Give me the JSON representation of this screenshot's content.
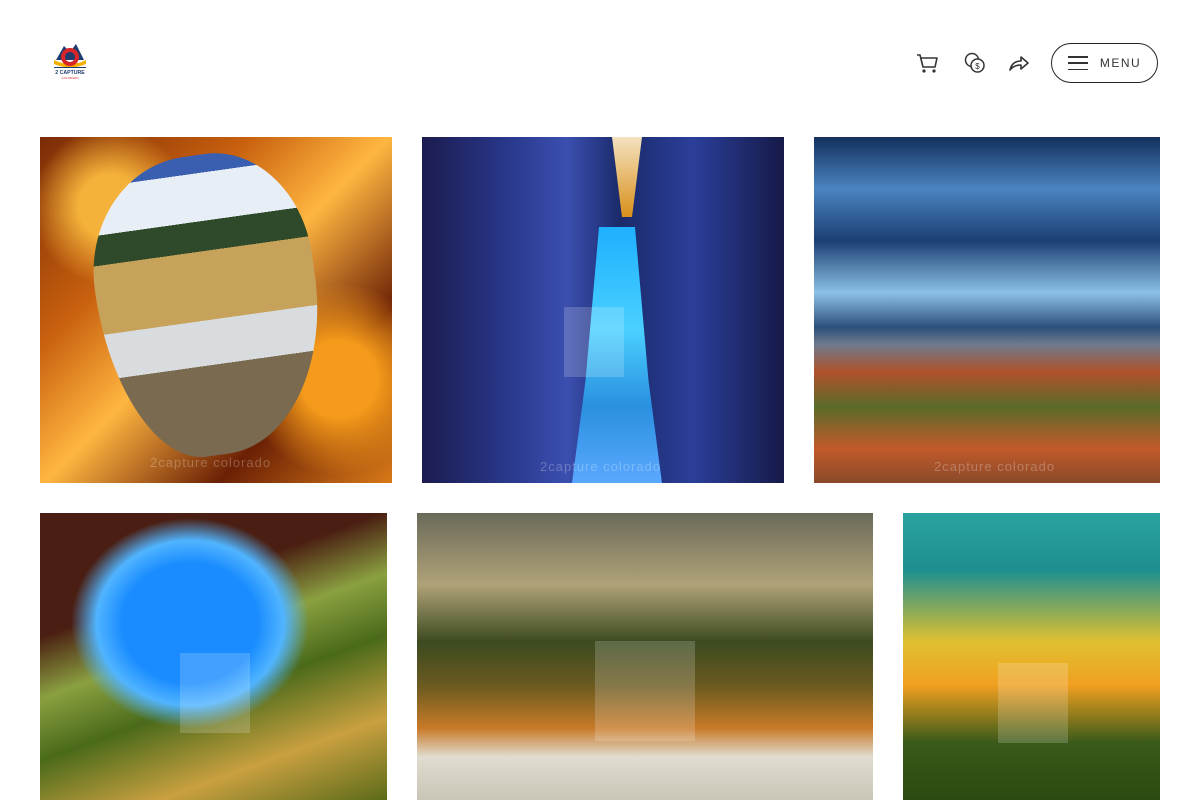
{
  "brand": {
    "logo_text": "2 CAPTURE",
    "logo_sub": "COLORADO"
  },
  "header": {
    "icons": [
      "cart-icon",
      "currency-icon",
      "share-icon",
      "menu-icon"
    ],
    "menu_label": "MENU"
  },
  "gallery": {
    "watermark": "2capture colorado",
    "tiles": [
      {
        "name": "photo-tile-wood-hole"
      },
      {
        "name": "photo-tile-ice-canyon"
      },
      {
        "name": "photo-tile-stormy-sky"
      },
      {
        "name": "photo-tile-rock-arch"
      },
      {
        "name": "photo-tile-forest"
      },
      {
        "name": "photo-tile-sunset-sky"
      }
    ]
  }
}
